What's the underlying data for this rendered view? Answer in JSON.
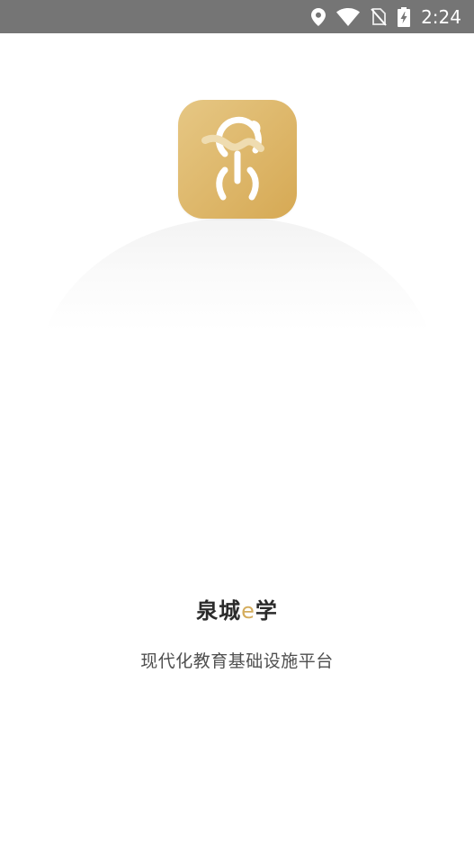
{
  "status_bar": {
    "time": "2:24",
    "icons": [
      "location-icon",
      "wifi-icon",
      "no-sim-icon",
      "battery-charging-icon"
    ],
    "background": "#757575"
  },
  "splash": {
    "logo_icon": "quancheng-logo-icon",
    "logo_color": "#dcb468",
    "app_name": {
      "part1": "泉城",
      "accent": "e",
      "part2": "学",
      "accent_color": "#d4ac5c"
    },
    "tagline": "现代化教育基础设施平台"
  }
}
